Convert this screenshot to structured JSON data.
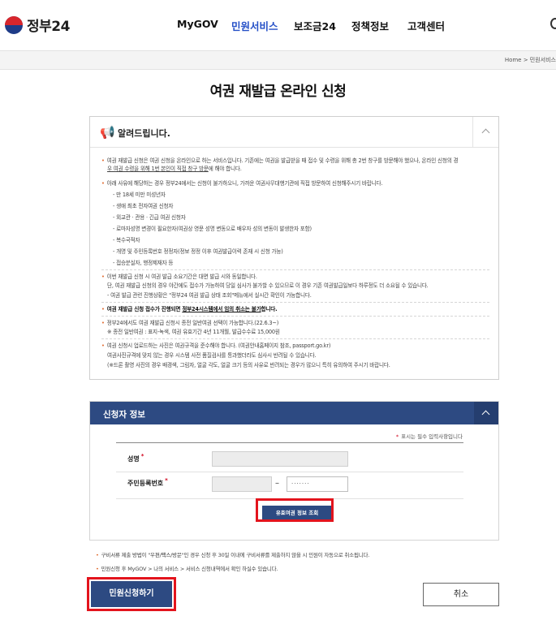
{
  "header": {
    "logo_text": "정부24",
    "nav": [
      "MyGOV",
      "민원서비스",
      "보조금24",
      "정책정보",
      "고객센터"
    ],
    "active_nav": "민원서비스"
  },
  "breadcrumb": "Home  >  민원서비스",
  "page_title": "여권 재발급 온라인 신청",
  "notice": {
    "title": "알려드립니다.",
    "lines": [
      "여권 재발급 신청은 여권 신청을 온라인으로 하는 서비스입니다. 기존에는 여권을 발급받을 때 접수 및 수령을 위해 총 2번 창구를 방문해야 했으나, 온라인 신청의 경",
      "우 여권 수령을 위해 1번 본인이 직접 창구 방문",
      "에 해야 합니다.",
      "아래 사유에 해당하는 경우 정부24에서는 신청이 불가하오니, 가까운 여권사무대행기관에 직접 방문하여 신청해주시기 바랍니다.",
      "- 만 18세 미만 미성년자",
      "- 생애 최초 전자여권 신청자",
      "- 외교관 · 관용 · 긴급 여권 신청자",
      "- 로마자성명 변경이 필요한자(여권상 영문 성명 변동으로 배우자 성의 변동이 발생한자 포함)",
      "- 복수국적자",
      "- 개명 및 주민등록번호 정정자(정보 정정 이후 여권발급이력 존재 시 신청 가능)",
      "- 접승분실자, 행정제재자 등",
      "이번 재발급 신청 시 여권 발급 소요기간은 대면 발급 시와 동일합니다.",
      "단, 여권 재발급 신청의 경우 야간에도 접수가 가능하여 당일 심사가 불가할 수 있으므로 이 경우 기존 여권발급일보다 하루정도 더 소요될 수 있습니다.",
      "- 여권 발급 관련 진행상황은 \"정부24 여권 발급 상태 조회\"메뉴에서 실시간 확인이 가능합니다.",
      "여권 재발급 신청 접수가 진행되면 ",
      "정부24시스템에서 임의 취소는 불가",
      "합니다.",
      "정부24에서도 여권 재발급 신청시 종전 일반여권 선택이 가능합니다.(22.6.3~)",
      "※ 종전 일반여권 : 표지-녹색, 여권 유효기간 4년 11개월, 발급수수료 15,000원",
      "여권 신청시 업로드하는 사진은 여권규격을 준수해야 합니다. (여권안내홈페이지 참조, passport.go.kr)",
      "여권사진규격에 맞지 않는 경우 시스템 사전 품질검사를 통과했더라도 심사시 반려될 수 있습니다.",
      "(※드론 촬영 사진의 경우 배경색, 그림자, 얼굴 각도, 얼굴 크기 등의 사유로 반려되는 경우가 많으니 특히 유의하여 주시기 바랍니다."
    ]
  },
  "applicant": {
    "title": "신청자 정보",
    "required_note": "표시는 필수 입력사항입니다",
    "name_label": "성명",
    "rrn_label": "주민등록번호",
    "rrn_back_value": "·······",
    "verify_button": "유효여권 정보 조회"
  },
  "footnotes": [
    "구비서류 제출 방법이 \"우편/팩스/방문\"인 경우 신청 후 30일 이내에 구비서류를 제출하지 않을 시 민원이 자동으로 취소됩니다.",
    "민원신청 후 MyGOV > 나의 서비스 > 서비스 신청내역에서 확인 하실수 있습니다."
  ],
  "buttons": {
    "submit": "민원신청하기",
    "cancel": "취소"
  },
  "colors": {
    "primary": "#2d4a82",
    "highlight": "#e3141d",
    "active_nav": "#2550c7",
    "bullet": "#e0672a"
  }
}
